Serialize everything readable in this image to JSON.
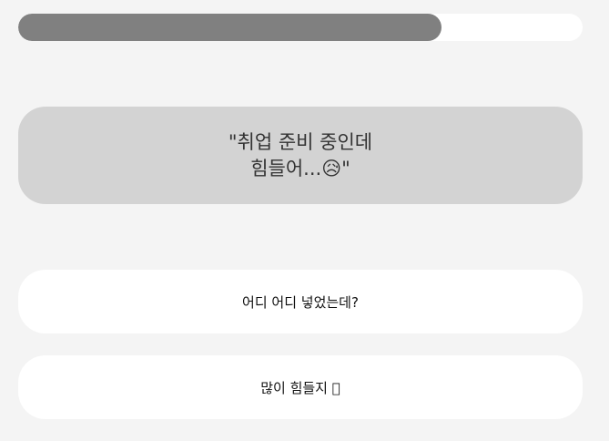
{
  "progress": {
    "value": 0.75,
    "fill_color": "#808080",
    "track_color": "#ffffff"
  },
  "question": {
    "text": "\"취업 준비 중인데\n힘들어...😥\""
  },
  "answers": [
    {
      "label": "어디 어디 넣었는데?"
    },
    {
      "label": "많이 힘들지 􀀀"
    }
  ],
  "colors": {
    "background": "#f4f4f4",
    "question_card": "#d3d3d3",
    "answer_button": "#ffffff"
  }
}
